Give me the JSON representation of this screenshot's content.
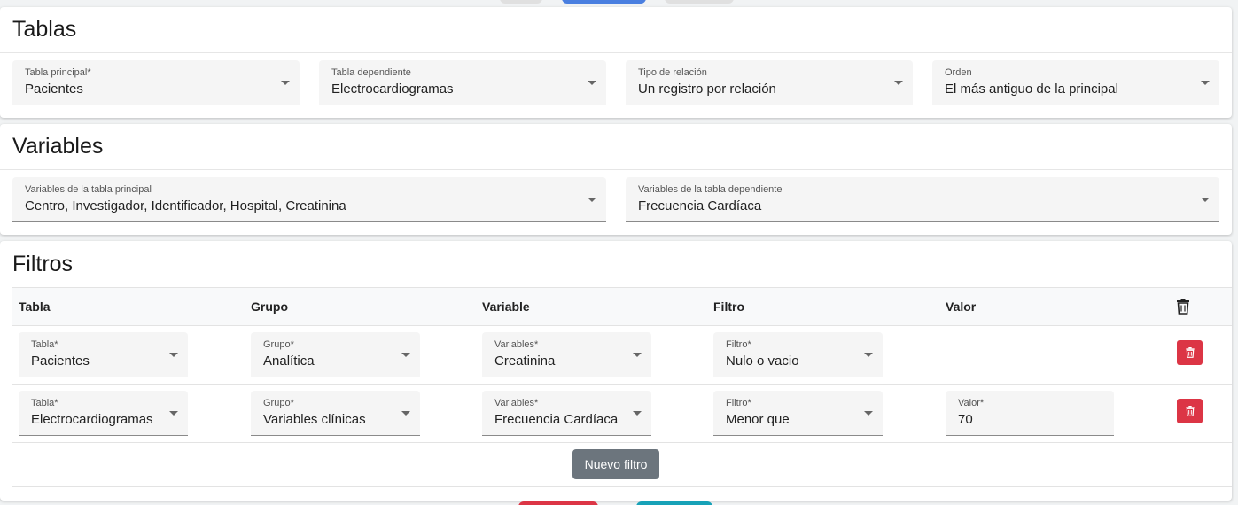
{
  "tablas": {
    "title": "Tablas",
    "fields": [
      {
        "label": "Tabla principal*",
        "value": "Pacientes"
      },
      {
        "label": "Tabla dependiente",
        "value": "Electrocardiogramas"
      },
      {
        "label": "Tipo de relación",
        "value": "Un registro por relación"
      },
      {
        "label": "Orden",
        "value": "El más antiguo de la principal"
      }
    ]
  },
  "variables": {
    "title": "Variables",
    "fields": [
      {
        "label": "Variables de la tabla principal",
        "value": "Centro, Investigador, Identificador, Hospital, Creatinina"
      },
      {
        "label": "Variables de la tabla dependiente",
        "value": "Frecuencia Cardíaca"
      }
    ]
  },
  "filtros": {
    "title": "Filtros",
    "headers": {
      "tabla": "Tabla",
      "grupo": "Grupo",
      "variable": "Variable",
      "filtro": "Filtro",
      "valor": "Valor"
    },
    "rows": [
      {
        "tabla": {
          "label": "Tabla*",
          "value": "Pacientes"
        },
        "grupo": {
          "label": "Grupo*",
          "value": "Analítica"
        },
        "variable": {
          "label": "Variables*",
          "value": "Creatinina"
        },
        "filtro": {
          "label": "Filtro*",
          "value": "Nulo o vacio"
        }
      },
      {
        "tabla": {
          "label": "Tabla*",
          "value": "Electrocardiogramas"
        },
        "grupo": {
          "label": "Grupo*",
          "value": "Variables clínicas"
        },
        "variable": {
          "label": "Variables*",
          "value": "Frecuencia Cardíaca"
        },
        "filtro": {
          "label": "Filtro*",
          "value": "Menor que"
        },
        "valor": {
          "label": "Valor*",
          "value": "70"
        }
      }
    ],
    "new_filter_label": "Nuevo filtro"
  },
  "colors": {
    "danger": "#dc3545",
    "secondary": "#6c757d",
    "primary": "#4a7fe0",
    "info": "#17a2b8"
  },
  "icons": {
    "delete": "trash-icon",
    "dropdown": "caret-down-icon"
  }
}
